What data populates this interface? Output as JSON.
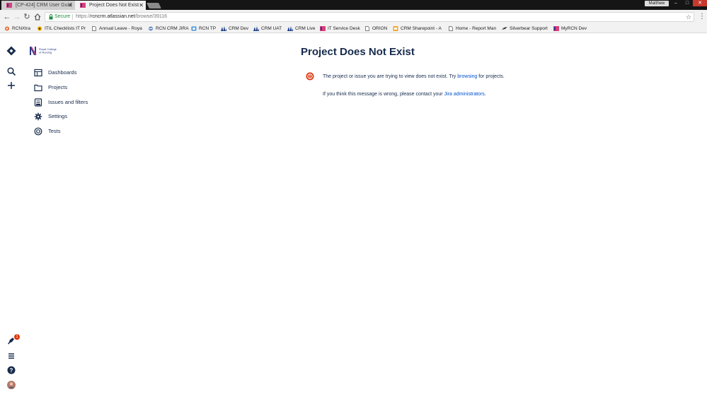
{
  "browser": {
    "tabs": [
      {
        "title": "[CP-424] CRM User Guid",
        "active": false
      },
      {
        "title": "Project Does Not Exist - ",
        "active": true
      }
    ],
    "user_name": "Matthew",
    "address": {
      "secure_label": "Secure",
      "url_scheme": "https://",
      "url_host": "rcncrm.atlassian.net",
      "url_path": "/browse/39116"
    },
    "bookmarks": [
      {
        "label": "RCNXtra",
        "icon": "rcn-flower-icon"
      },
      {
        "label": "ITIL Checklists  IT Pr",
        "icon": "itil-icon"
      },
      {
        "label": "Annual Leave - Roya",
        "icon": "page-icon"
      },
      {
        "label": "RCN CRM JIRA",
        "icon": "ie-icon"
      },
      {
        "label": "RCN TP",
        "icon": "tp-icon"
      },
      {
        "label": "CRM Dev",
        "icon": "dynamics-icon"
      },
      {
        "label": "CRM UAT",
        "icon": "dynamics-icon"
      },
      {
        "label": "CRM Live",
        "icon": "dynamics-icon"
      },
      {
        "label": "IT Service Desk",
        "icon": "rcn-n-icon"
      },
      {
        "label": "ORION",
        "icon": "page-icon"
      },
      {
        "label": "CRM Sharepoint - A",
        "icon": "sharepoint-icon"
      },
      {
        "label": "Home - Report Man",
        "icon": "page-icon"
      },
      {
        "label": "Silverbear Support",
        "icon": "silverbear-icon"
      },
      {
        "label": "MyRCN Dev",
        "icon": "rcn-n-icon"
      }
    ]
  },
  "global_nav": {
    "notifications_count": "1"
  },
  "project_nav": {
    "logo_text": [
      "Royal College",
      "of Nursing"
    ],
    "items": [
      {
        "label": "Dashboards",
        "icon": "dashboard-icon"
      },
      {
        "label": "Projects",
        "icon": "folder-icon"
      },
      {
        "label": "Issues and filters",
        "icon": "issues-icon"
      },
      {
        "label": "Settings",
        "icon": "gear-icon"
      },
      {
        "label": "Tests",
        "icon": "tests-icon"
      }
    ]
  },
  "main": {
    "title": "Project Does Not Exist",
    "message1_before": "The project or issue you are trying to view does not exist. Try ",
    "message1_link": "browsing",
    "message1_after": " for projects.",
    "message2_before": "If you think this message is wrong, please contact your ",
    "message2_link": "Jira administrators",
    "message2_after": "."
  },
  "colors": {
    "primary_text": "#172b4d",
    "link": "#0052cc",
    "error": "#de350b"
  }
}
